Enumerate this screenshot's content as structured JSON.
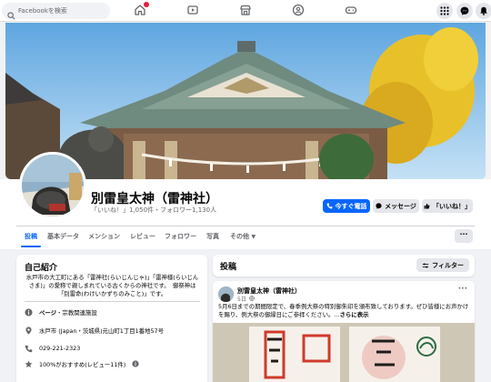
{
  "nav": {
    "search_placeholder": "Facebookを検索",
    "icons": [
      "home-icon",
      "video-icon",
      "marketplace-icon",
      "groups-icon",
      "gaming-icon"
    ],
    "right_icons": [
      "menu-grid-icon",
      "messenger-icon",
      "notifications-icon"
    ]
  },
  "page": {
    "name": "別雷皇太神（雷神社）",
    "stats": "「いいね！」1,050件・フォロワー1,130人"
  },
  "actions": {
    "call": "今すぐ電話",
    "message": "メッセージ",
    "like": "「いいね！」"
  },
  "tabs": [
    {
      "label": "投稿",
      "active": true
    },
    {
      "label": "基本データ",
      "active": false
    },
    {
      "label": "メンション",
      "active": false
    },
    {
      "label": "レビュー",
      "active": false
    },
    {
      "label": "フォロワー",
      "active": false
    },
    {
      "label": "写真",
      "active": false
    },
    {
      "label": "その他",
      "active": false
    }
  ],
  "more_button": "···",
  "intro": {
    "title": "自己紹介",
    "description": "水戸市の大工町にある「雷神社(らいじんじゃ)」「雷神様(らいじんさま)」の愛称で親しまれている古くからの神社です。　御祭神は「別雷命(わけいかずちのみこと)」です。",
    "page_label": "ページ",
    "page_category": "・宗教関連施設",
    "address": "水戸市 (Japan・茨城県)元山町1丁目1番地57号",
    "phone": "029-221-2323",
    "recommend": "100%がおすすめ(レビュー11件)"
  },
  "posts": {
    "title": "投稿",
    "filter": "フィルター",
    "author": "別雷皇太神（雷神社）",
    "date": "5日",
    "text": "5月6日までの期間限定で、春季例大祭の特別御朱印を頒布致しております。ぜひ皆様にお声かけを賜り、例大祭の御縁日にご参拝ください。...",
    "more": "さらに表示",
    "menu": "···"
  },
  "colors": {
    "accent": "#0866ff",
    "background": "#f0f2f5",
    "card": "#ffffff",
    "notification": "#e41e3f"
  }
}
